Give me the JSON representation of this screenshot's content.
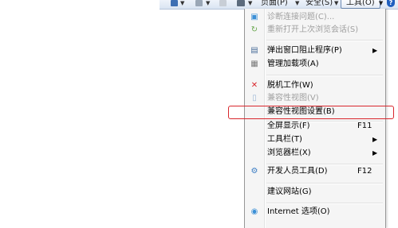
{
  "commandbar": {
    "page_label": "页面(P)",
    "safety_label": "安全(S)",
    "tools_label": "工具(O)",
    "help_label": "?",
    "arrow": "▼"
  },
  "menu": {
    "items": [
      {
        "label": "诊断连接问题(C)...",
        "shortcut": "",
        "submenu": false,
        "disabled": true,
        "icon": "diagnose-icon"
      },
      {
        "label": "重新打开上次浏览会话(S)",
        "shortcut": "",
        "submenu": false,
        "disabled": true,
        "icon": "reopen-session-icon"
      },
      {
        "label": "弹出窗口阻止程序(P)",
        "shortcut": "",
        "submenu": true,
        "disabled": false,
        "icon": "popup-blocker-icon"
      },
      {
        "label": "管理加载项(A)",
        "shortcut": "",
        "submenu": false,
        "disabled": false,
        "icon": "addons-icon"
      },
      {
        "label": "脱机工作(W)",
        "shortcut": "",
        "submenu": false,
        "disabled": false,
        "icon": "offline-icon"
      },
      {
        "label": "兼容性视图(V)",
        "shortcut": "",
        "submenu": false,
        "disabled": true,
        "icon": "compat-view-icon"
      },
      {
        "label": "兼容性视图设置(B)",
        "shortcut": "",
        "submenu": false,
        "disabled": false,
        "icon": ""
      },
      {
        "label": "全屏显示(F)",
        "shortcut": "F11",
        "submenu": false,
        "disabled": false,
        "icon": ""
      },
      {
        "label": "工具栏(T)",
        "shortcut": "",
        "submenu": true,
        "disabled": false,
        "icon": ""
      },
      {
        "label": "浏览器栏(X)",
        "shortcut": "",
        "submenu": true,
        "disabled": false,
        "icon": ""
      },
      {
        "label": "开发人员工具(D)",
        "shortcut": "F12",
        "submenu": false,
        "disabled": false,
        "icon": "developer-tools-icon"
      },
      {
        "label": "建议网站(G)",
        "shortcut": "",
        "submenu": false,
        "disabled": false,
        "icon": ""
      },
      {
        "label": "Internet 选项(O)",
        "shortcut": "",
        "submenu": false,
        "disabled": false,
        "icon": "internet-options-icon"
      }
    ],
    "submenu_arrow": "▶"
  },
  "colors": {
    "highlight": "#d9262c",
    "disabled_text": "#a0a0a0"
  }
}
